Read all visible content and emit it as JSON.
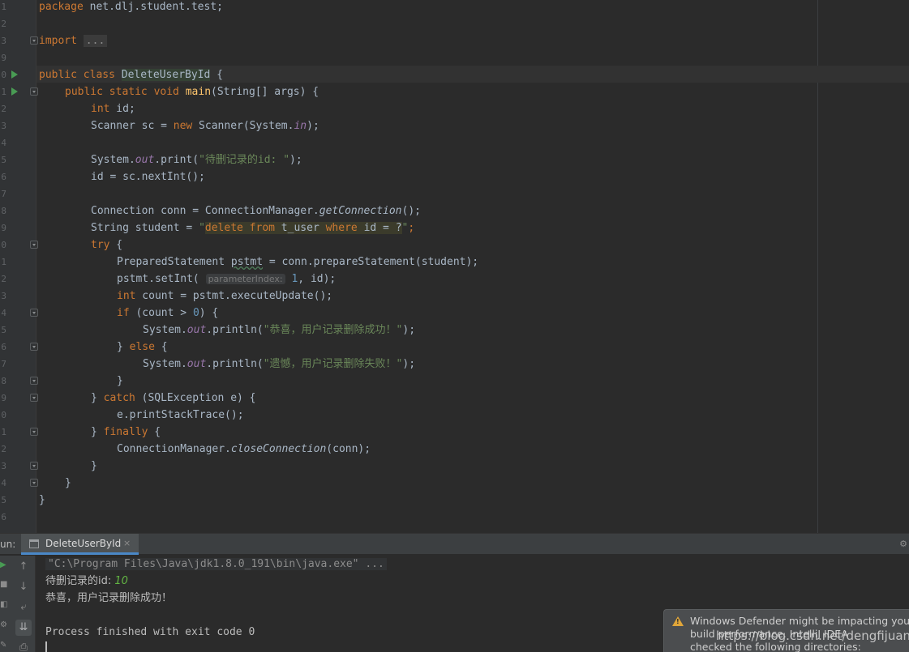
{
  "editor": {
    "line_numbers": [
      "1",
      "2",
      "3",
      "9",
      "0",
      "1",
      "2",
      "3",
      "4",
      "5",
      "6",
      "7",
      "8",
      "9",
      "0",
      "1",
      "2",
      "3",
      "4",
      "5",
      "6",
      "7",
      "8",
      "9",
      "0",
      "1",
      "2",
      "3",
      "4",
      "5",
      "6"
    ],
    "lines": {
      "l1_kw": "package",
      "l1_rest": " net.dlj.student.test;",
      "l3_kw": "import",
      "l3_fold": "...",
      "l5_kw": "public class",
      "l5_cls": "DeleteUserById",
      "l5_rest": " {",
      "l6_kw": "public static void",
      "l6_fn": "main",
      "l6_rest": "(String[] args) {",
      "l7_kw": "int",
      "l7_rest": " id;",
      "l8_a": "Scanner sc = ",
      "l8_kw": "new",
      "l8_b": " Scanner(System.",
      "l8_field": "in",
      "l8_c": ");",
      "l10_a": "System.",
      "l10_field": "out",
      "l10_b": ".print(",
      "l10_str": "\"待删记录的id: \"",
      "l10_c": ");",
      "l11": "id = sc.nextInt();",
      "l13_a": "Connection conn = ConnectionManager.",
      "l13_it": "getConnection",
      "l13_b": "();",
      "l14_a": "String student = ",
      "l14_q1": "\"",
      "l14_sql_kw1": "delete from",
      "l14_sql_mid": " t_user ",
      "l14_sql_kw2": "where",
      "l14_sql_end": " id = ?",
      "l14_q2": "\"",
      "l14_b": ";",
      "l15_kw": "try",
      "l15_rest": " {",
      "l16_a": "PreparedStatement ",
      "l16_var": "pstmt",
      "l16_b": " = conn.prepareStatement(student);",
      "l17_a": "pstmt.setInt( ",
      "l17_hint": "parameterIndex:",
      "l17_num": " 1",
      "l17_b": ", id);",
      "l18_kw": "int",
      "l18_rest": " count = pstmt.executeUpdate();",
      "l19_kw": "if",
      "l19_a": " (count > ",
      "l19_num": "0",
      "l19_b": ") {",
      "l20_a": "System.",
      "l20_field": "out",
      "l20_b": ".println(",
      "l20_str": "\"恭喜，用户记录删除成功！\"",
      "l20_c": ");",
      "l21_a": "} ",
      "l21_kw": "else",
      "l21_b": " {",
      "l22_a": "System.",
      "l22_field": "out",
      "l22_b": ".println(",
      "l22_str": "\"遗憾，用户记录删除失败！\"",
      "l22_c": ");",
      "l23": "}",
      "l24_a": "} ",
      "l24_kw": "catch",
      "l24_b": " (SQLException e) {",
      "l25": "e.printStackTrace();",
      "l26_a": "} ",
      "l26_kw": "finally",
      "l26_b": " {",
      "l27_a": "ConnectionManager.",
      "l27_it": "closeConnection",
      "l27_b": "(conn);",
      "l28": "}",
      "l29": "}",
      "l30": "}"
    }
  },
  "run_panel": {
    "label": "un:",
    "tab_label": "DeleteUserById",
    "tab_close": "×",
    "gear_icon": "gear-icon",
    "console": {
      "command": "\"C:\\Program Files\\Java\\jdk1.8.0_191\\bin\\java.exe\" ...",
      "prompt": "待删记录的id: ",
      "input": "10",
      "result": "恭喜，用户记录删除成功！",
      "exit": "Process finished with exit code 0"
    }
  },
  "notification": {
    "line1": "Windows Defender might be impacting your",
    "line2": "build performance. IntelliJ IDEA",
    "line3": "checked the following directories:"
  },
  "watermark": "https://blog.csdn.net/dengfijuan_",
  "colors": {
    "keyword": "#cc7832",
    "string": "#6a8759",
    "function": "#ffc66d",
    "field": "#9876aa",
    "number": "#6897bb",
    "run_green": "#499c54",
    "tab_underline": "#4a88c7"
  }
}
